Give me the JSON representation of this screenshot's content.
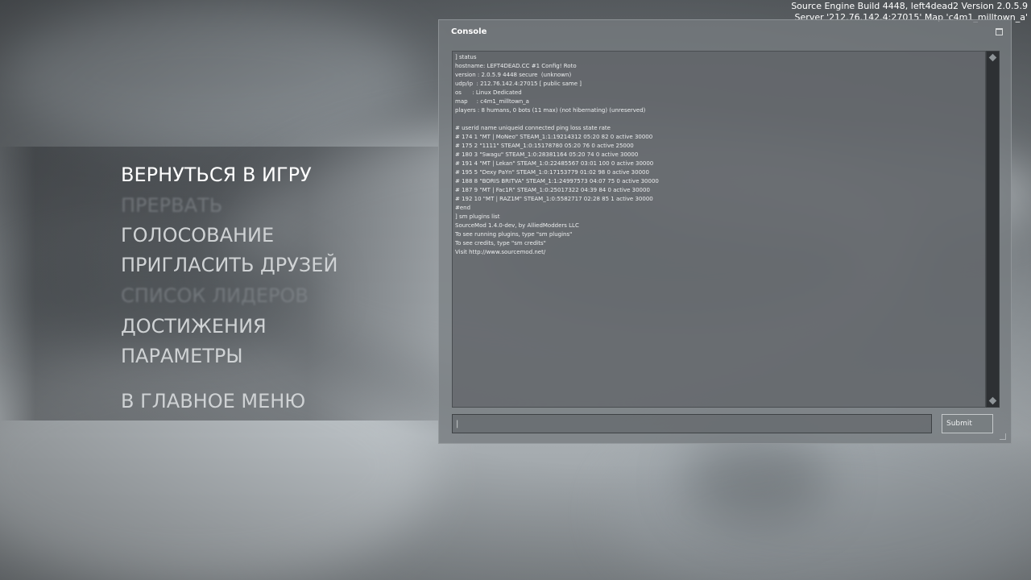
{
  "version_info": {
    "line1": "Source Engine Build 4448, left4dead2 Version 2.0.5.9",
    "line2": "Server '212.76.142.4:27015' Map 'c4m1_milltown_a'"
  },
  "menu": {
    "items": [
      {
        "label": "ВЕРНУТЬСЯ В ИГРУ",
        "state": "active"
      },
      {
        "label": "ПРЕРВАТЬ",
        "state": "disabled"
      },
      {
        "label": "ГОЛОСОВАНИЕ",
        "state": "normal"
      },
      {
        "label": "ПРИГЛАСИТЬ ДРУЗЕЙ",
        "state": "normal"
      },
      {
        "label": "СПИСОК ЛИДЕРОВ",
        "state": "disabled"
      },
      {
        "label": "ДОСТИЖЕНИЯ",
        "state": "normal"
      },
      {
        "label": "ПАРАМЕТРЫ",
        "state": "normal"
      },
      {
        "label": "В ГЛАВНОЕ МЕНЮ",
        "state": "normal"
      }
    ]
  },
  "console": {
    "title": "Console",
    "output_lines": [
      "] status",
      "hostname: LEFT4DEAD.CC #1 Config! Roto",
      "version : 2.0.5.9 4448 secure  (unknown)",
      "udp/ip  : 212.76.142.4:27015 [ public same ]",
      "os      : Linux Dedicated",
      "map     : c4m1_milltown_a",
      "players : 8 humans, 0 bots (11 max) (not hibernating) (unreserved)",
      "",
      "# userid name uniqueid connected ping loss state rate",
      "# 174 1 \"MT | MoNeo\" STEAM_1:1:19214312 05:20 82 0 active 30000",
      "# 175 2 \"1111\" STEAM_1:0:15178780 05:20 76 0 active 25000",
      "# 180 3 \"Swagu\" STEAM_1:0:28381164 05:20 74 0 active 30000",
      "# 191 4 \"MT | Lekan\" STEAM_1:0:22485567 03:01 100 0 active 30000",
      "# 195 5 \"Dexy PaYn\" STEAM_1:0:17153779 01:02 98 0 active 30000",
      "# 188 8 \"BORIS BRITVA\" STEAM_1:1:24997573 04:07 75 0 active 30000",
      "# 187 9 \"MT | Fac1R\" STEAM_1:0:25017322 04:39 84 0 active 30000",
      "# 192 10 \"MT | RAZ1M\" STEAM_1:0:5582717 02:28 85 1 active 30000",
      "#end",
      "] sm plugins list",
      "SourceMod 1.4.0-dev, by AlliedModders LLC",
      "To see running plugins, type \"sm plugins\"",
      "To see credits, type \"sm credits\"",
      "Visit http://www.sourcemod.net/"
    ],
    "input_value": "",
    "input_placeholder": "|",
    "submit_label": "Submit"
  }
}
